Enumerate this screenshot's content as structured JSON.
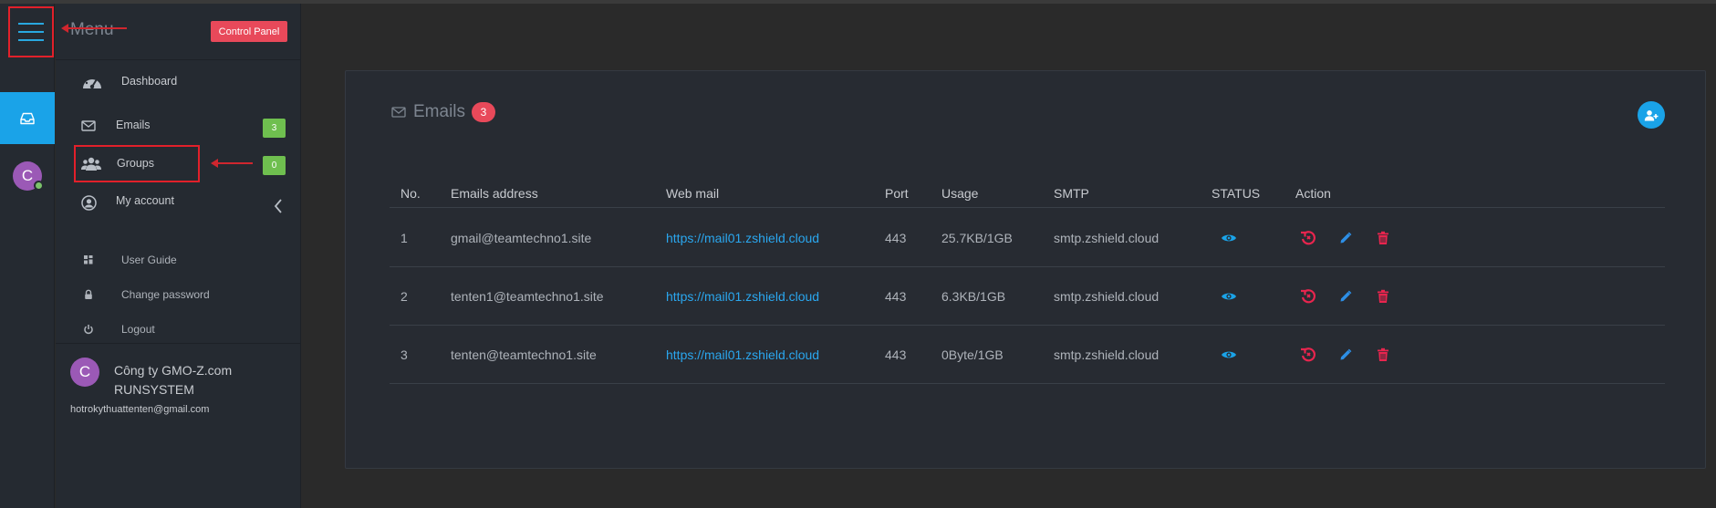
{
  "menu": {
    "title": "Menu",
    "control_panel": "Control Panel",
    "items": [
      {
        "label": "Dashboard"
      },
      {
        "label": "Emails",
        "badge": "3"
      },
      {
        "label": "Groups",
        "badge": "0"
      },
      {
        "label": "My account"
      }
    ],
    "sub_items": [
      {
        "label": "User Guide"
      },
      {
        "label": "Change password"
      },
      {
        "label": "Logout"
      }
    ],
    "user": {
      "avatar_letter": "C",
      "company_line1": "Công ty GMO-Z.com",
      "company_line2": "RUNSYSTEM",
      "email": "hotrokythuattenten@gmail.com"
    }
  },
  "rail": {
    "avatar_letter": "C"
  },
  "emails_card": {
    "title": "Emails",
    "count": "3",
    "columns": [
      "No.",
      "Emails address",
      "Web mail",
      "Port",
      "Usage",
      "SMTP",
      "STATUS",
      "Action"
    ],
    "rows": [
      {
        "no": "1",
        "email": "gmail@teamtechno1.site",
        "webmail": "https://mail01.zshield.cloud",
        "port": "443",
        "usage": "25.7KB/1GB",
        "smtp": "smtp.zshield.cloud"
      },
      {
        "no": "2",
        "email": "tenten1@teamtechno1.site",
        "webmail": "https://mail01.zshield.cloud",
        "port": "443",
        "usage": "6.3KB/1GB",
        "smtp": "smtp.zshield.cloud"
      },
      {
        "no": "3",
        "email": "tenten@teamtechno1.site",
        "webmail": "https://mail01.zshield.cloud",
        "port": "443",
        "usage": "0Byte/1GB",
        "smtp": "smtp.zshield.cloud"
      }
    ]
  },
  "colors": {
    "accent_blue": "#1aa3e8",
    "badge_red": "#e8495a",
    "badge_green": "#6fbf4f",
    "annotation_red": "#e2202a"
  }
}
